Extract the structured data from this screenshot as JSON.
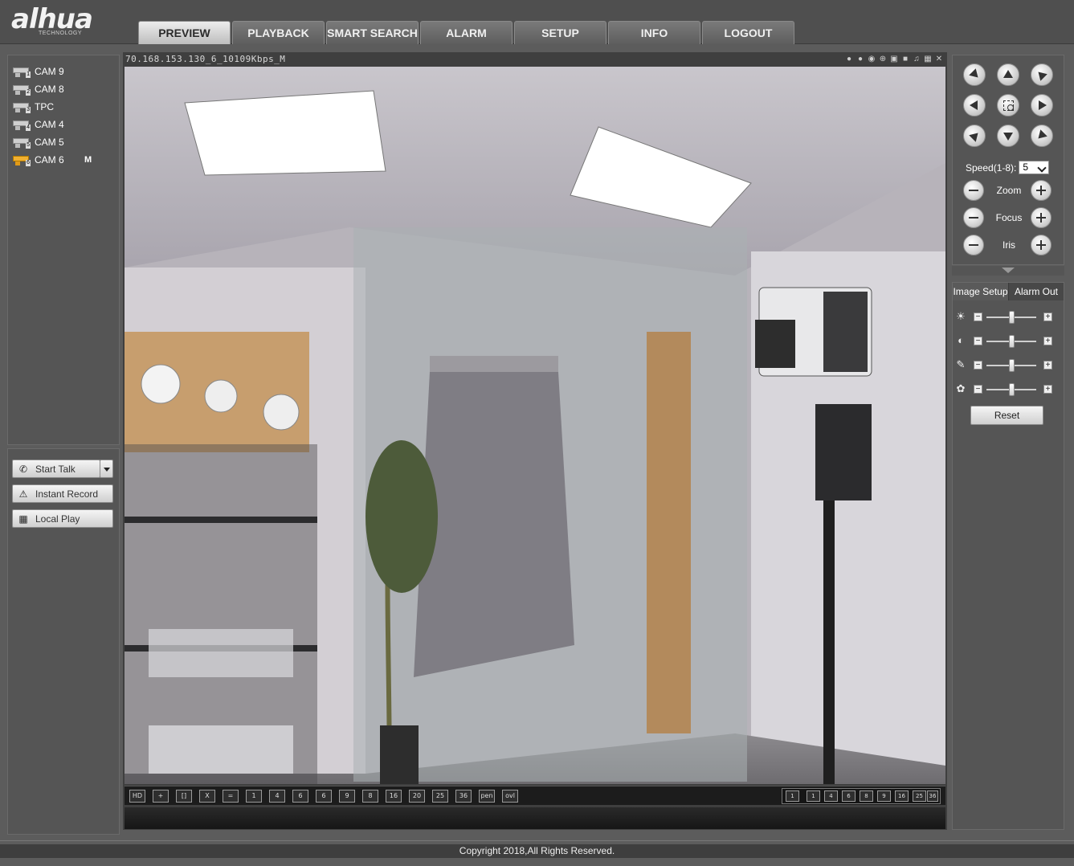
{
  "header": {
    "logo_text": "alhua",
    "logo_sub": "TECHNOLOGY",
    "tabs": [
      {
        "label": "PREVIEW",
        "active": true
      },
      {
        "label": "PLAYBACK"
      },
      {
        "label": "SMART SEARCH"
      },
      {
        "label": "ALARM"
      },
      {
        "label": "SETUP"
      },
      {
        "label": "INFO"
      },
      {
        "label": "LOGOUT"
      }
    ]
  },
  "channels": [
    {
      "label": "CAM 9",
      "num": "1",
      "flag": ""
    },
    {
      "label": "CAM 8",
      "num": "2",
      "flag": ""
    },
    {
      "label": "TPC",
      "num": "3",
      "flag": ""
    },
    {
      "label": "CAM 4",
      "num": "4",
      "flag": ""
    },
    {
      "label": "CAM 5",
      "num": "5",
      "flag": ""
    },
    {
      "label": "CAM 6",
      "num": "6",
      "flag": "M",
      "active": true
    }
  ],
  "actions": {
    "start_talk": "Start Talk",
    "instant_record": "Instant Record",
    "local_play": "Local Play"
  },
  "video": {
    "title": "70.168.153.130_6_10109Kbps_M"
  },
  "toolbar": {
    "left": [
      "HD",
      "+",
      "[]",
      "X",
      "=",
      "1",
      "4",
      "6",
      "6",
      "9",
      "8",
      "16",
      "20",
      "25",
      "36",
      "pen",
      "ovl"
    ],
    "right": [
      "1",
      "1",
      "4",
      "6",
      "8",
      "9",
      "16",
      "25",
      "36"
    ]
  },
  "ptz": {
    "speed_label": "Speed(1-8):",
    "speed_value": "5",
    "zoom": "Zoom",
    "focus": "Focus",
    "iris": "Iris"
  },
  "image_setup": {
    "tab_image": "Image Setup",
    "tab_alarm": "Alarm Out",
    "reset": "Reset",
    "sliders": [
      {
        "icon": "brightness-icon",
        "value": 50
      },
      {
        "icon": "contrast-icon",
        "value": 50
      },
      {
        "icon": "saturation-icon",
        "value": 50
      },
      {
        "icon": "hue-icon",
        "value": 50
      }
    ]
  },
  "footer": {
    "copyright": "Copyright 2018,All Rights Reserved."
  },
  "colors": {
    "active_channel": "#f0b030",
    "background": "#5c5c5c"
  }
}
